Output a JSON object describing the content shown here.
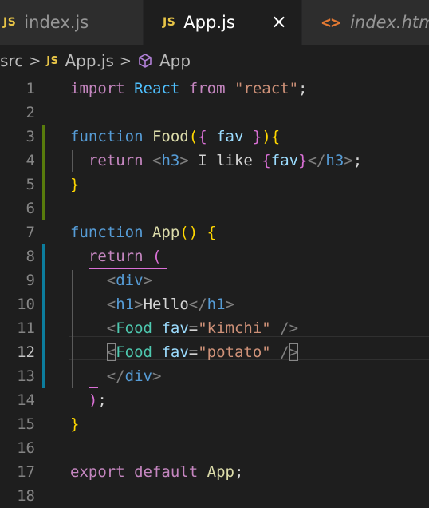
{
  "tabs": [
    {
      "icon": "js-icon",
      "badge": "JS",
      "label": "index.js",
      "active": false
    },
    {
      "icon": "js-icon",
      "badge": "JS",
      "label": "App.js",
      "active": true,
      "close": "×"
    },
    {
      "icon": "html-icon",
      "badge": "<>",
      "label": "index.html",
      "active": false
    }
  ],
  "breadcrumb": {
    "folder": "src",
    "separator": ">",
    "file_badge": "JS",
    "file": "App.js",
    "symbol_icon": "cube-icon",
    "symbol": "App"
  },
  "editor": {
    "active_line": 12,
    "line_numbers": [
      "1",
      "2",
      "3",
      "4",
      "5",
      "6",
      "7",
      "8",
      "9",
      "10",
      "11",
      "12",
      "13",
      "14",
      "15",
      "16",
      "17",
      "18"
    ],
    "lines": [
      [
        [
          "kw",
          "import"
        ],
        [
          "plain",
          " "
        ],
        [
          "var",
          "React"
        ],
        [
          "plain",
          " "
        ],
        [
          "kw",
          "from"
        ],
        [
          "plain",
          " "
        ],
        [
          "str",
          "\"react\""
        ],
        [
          "plain",
          ";"
        ]
      ],
      [],
      [
        [
          "fn-kw",
          "function"
        ],
        [
          "plain",
          " "
        ],
        [
          "fname",
          "Food"
        ],
        [
          "b1",
          "("
        ],
        [
          "b2",
          "{"
        ],
        [
          "plain",
          " "
        ],
        [
          "param",
          "fav"
        ],
        [
          "plain",
          " "
        ],
        [
          "b2",
          "}"
        ],
        [
          "b1",
          ")"
        ],
        [
          "b1",
          "{"
        ]
      ],
      [
        [
          "plain",
          "  "
        ],
        [
          "kw",
          "return"
        ],
        [
          "plain",
          " "
        ],
        [
          "punc",
          "<"
        ],
        [
          "tag",
          "h3"
        ],
        [
          "punc",
          ">"
        ],
        [
          "plain",
          " I like "
        ],
        [
          "b2",
          "{"
        ],
        [
          "param",
          "fav"
        ],
        [
          "b2",
          "}"
        ],
        [
          "punc",
          "</"
        ],
        [
          "tag",
          "h3"
        ],
        [
          "punc",
          ">"
        ],
        [
          "plain",
          ";"
        ]
      ],
      [
        [
          "b1",
          "}"
        ]
      ],
      [],
      [
        [
          "fn-kw",
          "function"
        ],
        [
          "plain",
          " "
        ],
        [
          "fname",
          "App"
        ],
        [
          "b1",
          "()"
        ],
        [
          "plain",
          " "
        ],
        [
          "b1",
          "{"
        ]
      ],
      [
        [
          "plain",
          "  "
        ],
        [
          "kw",
          "return"
        ],
        [
          "plain",
          " "
        ],
        [
          "b2",
          "("
        ]
      ],
      [
        [
          "plain",
          "    "
        ],
        [
          "punc",
          "<"
        ],
        [
          "tag",
          "div"
        ],
        [
          "punc",
          ">"
        ]
      ],
      [
        [
          "plain",
          "    "
        ],
        [
          "punc",
          "<"
        ],
        [
          "tag",
          "h1"
        ],
        [
          "punc",
          ">"
        ],
        [
          "plain",
          "Hello"
        ],
        [
          "punc",
          "</"
        ],
        [
          "tag",
          "h1"
        ],
        [
          "punc",
          ">"
        ]
      ],
      [
        [
          "plain",
          "    "
        ],
        [
          "punc",
          "<"
        ],
        [
          "comp",
          "Food"
        ],
        [
          "plain",
          " "
        ],
        [
          "attr",
          "fav"
        ],
        [
          "plain",
          "="
        ],
        [
          "str",
          "\"kimchi\""
        ],
        [
          "plain",
          " "
        ],
        [
          "punc",
          "/>"
        ]
      ],
      [
        [
          "plain",
          "    "
        ],
        [
          "punc boxed",
          "<"
        ],
        [
          "comp",
          "Food"
        ],
        [
          "plain",
          " "
        ],
        [
          "attr",
          "fav"
        ],
        [
          "plain",
          "="
        ],
        [
          "str",
          "\"potato\""
        ],
        [
          "plain",
          " "
        ],
        [
          "punc",
          "/"
        ],
        [
          "punc boxed",
          ">"
        ]
      ],
      [
        [
          "plain",
          "    "
        ],
        [
          "punc",
          "</"
        ],
        [
          "tag",
          "div"
        ],
        [
          "punc",
          ">"
        ]
      ],
      [
        [
          "plain",
          "  "
        ],
        [
          "b2",
          ")"
        ],
        [
          "plain",
          ";"
        ]
      ],
      [
        [
          "b1",
          "}"
        ]
      ],
      [],
      [
        [
          "kw",
          "export"
        ],
        [
          "plain",
          " "
        ],
        [
          "kw",
          "default"
        ],
        [
          "plain",
          " "
        ],
        [
          "fname",
          "App"
        ],
        [
          "plain",
          ";"
        ]
      ],
      []
    ]
  },
  "colors": {
    "background": "#1e1e1e",
    "gutter_modified": "#587c0c",
    "gutter_added": "#0c7d9d",
    "bracket_guide": "#da70d6"
  }
}
